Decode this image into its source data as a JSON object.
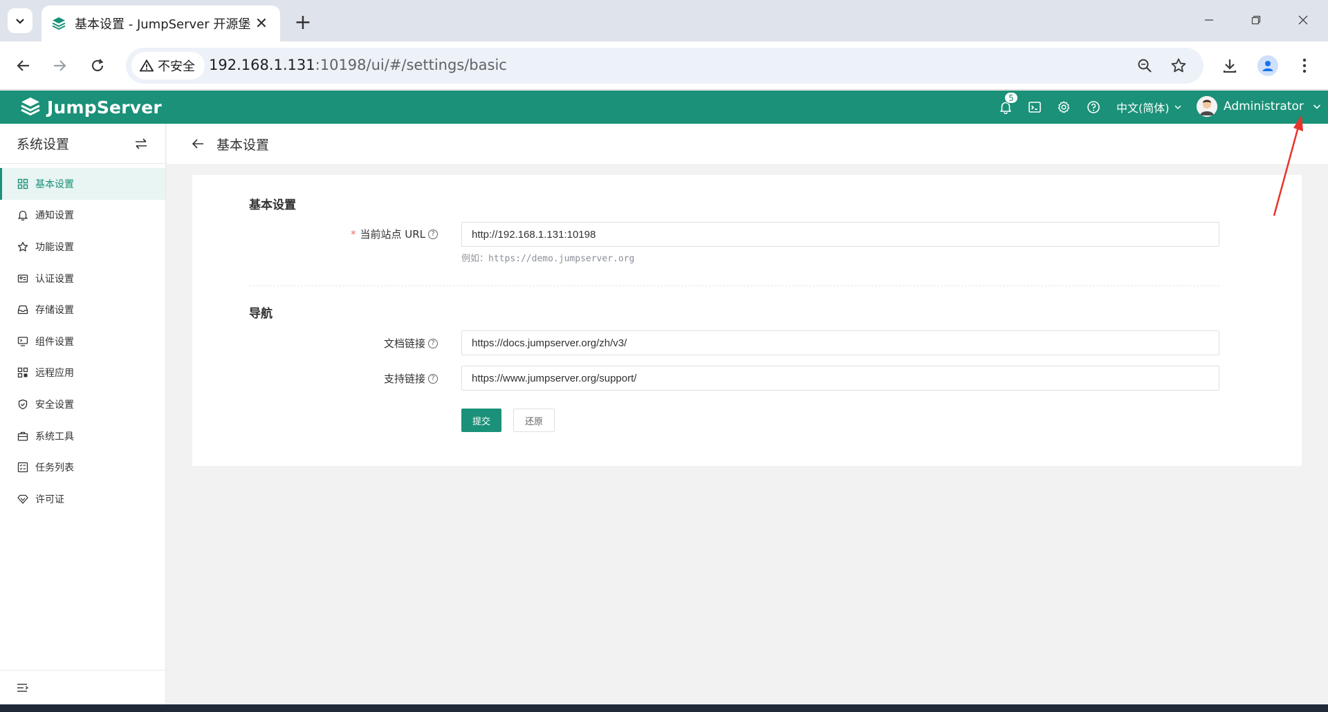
{
  "browser": {
    "tab_title": "基本设置 - JumpServer 开源堡",
    "security_label": "不安全",
    "url_host": "192.168.1.131",
    "url_rest": ":10198/ui/#/settings/basic"
  },
  "header": {
    "logo_text": "JumpServer",
    "notification_count": "5",
    "language": "中文(简体)",
    "username": "Administrator"
  },
  "sidebar": {
    "title": "系统设置",
    "items": [
      {
        "label": "基本设置",
        "icon": "grid-icon",
        "active": true
      },
      {
        "label": "通知设置",
        "icon": "bell-icon"
      },
      {
        "label": "功能设置",
        "icon": "feature-icon"
      },
      {
        "label": "认证设置",
        "icon": "id-card-icon"
      },
      {
        "label": "存储设置",
        "icon": "inbox-icon"
      },
      {
        "label": "组件设置",
        "icon": "monitor-icon"
      },
      {
        "label": "远程应用",
        "icon": "apps-icon"
      },
      {
        "label": "安全设置",
        "icon": "shield-icon"
      },
      {
        "label": "系统工具",
        "icon": "toolbox-icon"
      },
      {
        "label": "任务列表",
        "icon": "task-list-icon"
      },
      {
        "label": "许可证",
        "icon": "license-icon"
      }
    ]
  },
  "page": {
    "title": "基本设置",
    "sections": {
      "basic": "基本设置",
      "nav": "导航"
    },
    "fields": {
      "site_url": {
        "label": "当前站点 URL",
        "value": "http://192.168.1.131:10198",
        "hint_prefix": "例如：",
        "hint_url": "https://demo.jumpserver.org"
      },
      "docs_link": {
        "label": "文档链接",
        "value": "https://docs.jumpserver.org/zh/v3/"
      },
      "support_link": {
        "label": "支持链接",
        "value": "https://www.jumpserver.org/support/"
      }
    },
    "buttons": {
      "submit": "提交",
      "reset": "还原"
    }
  },
  "colors": {
    "brand": "#1a9178",
    "annotation": "#e8332a"
  }
}
